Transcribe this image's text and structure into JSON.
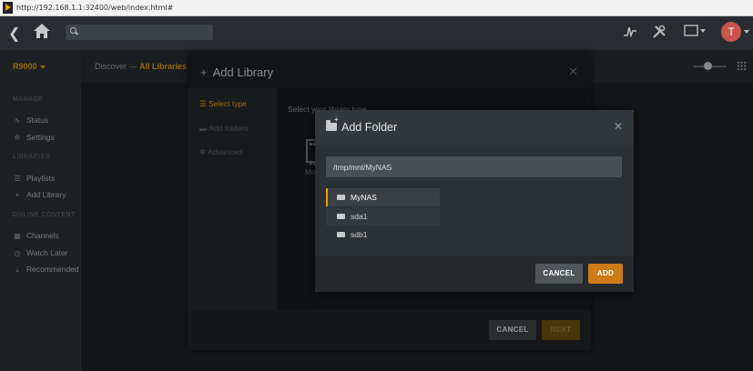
{
  "browser": {
    "url": "http://192.168.1.1:32400/web/index.html#"
  },
  "sidebar": {
    "server": "R9000",
    "sections": [
      {
        "heading": "MANAGE",
        "items": [
          {
            "label": "Status",
            "icon": "activity-icon"
          },
          {
            "label": "Settings",
            "icon": "gear-icon"
          }
        ]
      },
      {
        "heading": "LIBRARIES",
        "items": [
          {
            "label": "Playlists",
            "icon": "list-icon"
          },
          {
            "label": "Add Library",
            "icon": "plus-icon"
          }
        ]
      },
      {
        "heading": "ONLINE CONTENT",
        "items": [
          {
            "label": "Channels",
            "icon": "grid-icon"
          },
          {
            "label": "Watch Later",
            "icon": "clock-icon"
          },
          {
            "label": "Recommended",
            "icon": "download-icon"
          }
        ]
      }
    ]
  },
  "header": {
    "discover": "Discover",
    "separator": "—",
    "current": "All Libraries"
  },
  "add_library": {
    "title": "Add Library",
    "steps": [
      "Select type",
      "Add folders",
      "Advanced"
    ],
    "prompt": "Select your library type",
    "type_label": "Movies",
    "cancel": "CANCEL",
    "next": "NEXT"
  },
  "add_folder": {
    "title": "Add Folder",
    "path": "/tmp/mnt/MyNAS",
    "folders": [
      "MyNAS",
      "sda1",
      "sdb1"
    ],
    "cancel": "CANCEL",
    "add": "ADD"
  },
  "colors": {
    "accent": "#e5a00d",
    "avatar": "#c8544e"
  },
  "user": {
    "initial": "T"
  }
}
